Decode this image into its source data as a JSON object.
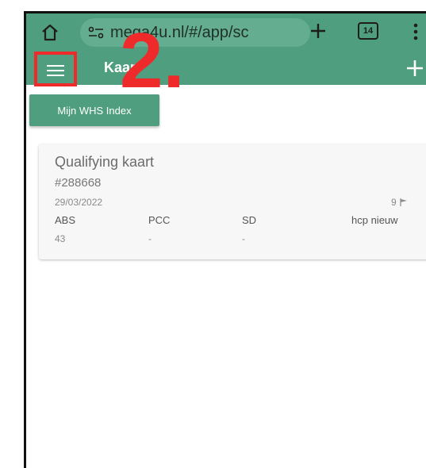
{
  "browser": {
    "url": "mega4u.nl/#/app/sc",
    "tab_count": "14"
  },
  "app_bar": {
    "title": "Kaart"
  },
  "annotation": {
    "label": "2."
  },
  "whs_button": {
    "label": "Mijn WHS Index"
  },
  "card": {
    "title": "Qualifying kaart",
    "id": "#288668",
    "date": "29/03/2022",
    "holes": "9",
    "columns": [
      "ABS",
      "PCC",
      "SD",
      "hcp nieuw"
    ],
    "values": [
      "43",
      "-",
      "-",
      ""
    ]
  },
  "colors": {
    "primary": "#4f9e7f",
    "annotation": "#ee2a2a"
  }
}
